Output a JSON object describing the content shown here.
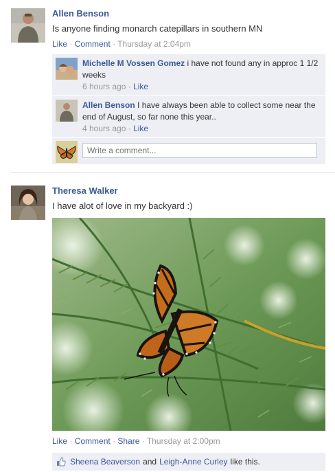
{
  "posts": [
    {
      "author": "Allen Benson",
      "message": "Is anyone finding monarch catepillars in southern MN",
      "actions": {
        "like": "Like",
        "comment": "Comment",
        "time": "Thursday at 2:04pm"
      },
      "comments": [
        {
          "author": "Michelle M Vossen Gomez",
          "text": "i have not found any in approc 1 1/2 weeks",
          "time": "6 hours ago",
          "like": "Like"
        },
        {
          "author": "Allen Benson",
          "text": "I have always been able to collect some near the end of August, so far none this year..",
          "time": "4 hours ago",
          "like": "Like"
        }
      ],
      "comment_input": {
        "placeholder": "Write a comment..."
      }
    },
    {
      "author": "Theresa Walker",
      "message": "I have alot of love in my backyard :)",
      "actions": {
        "like": "Like",
        "comment": "Comment",
        "share": "Share",
        "time": "Thursday at 2:00pm"
      },
      "likes": {
        "user1": "Sheena Beaverson",
        "and": "and",
        "user2": "Leigh-Anne Curley",
        "suffix": "like this."
      }
    }
  ],
  "separator_dot": "·",
  "colors": {
    "link": "#3b5998",
    "comment_bg": "#edeff4",
    "meta": "#999999"
  }
}
